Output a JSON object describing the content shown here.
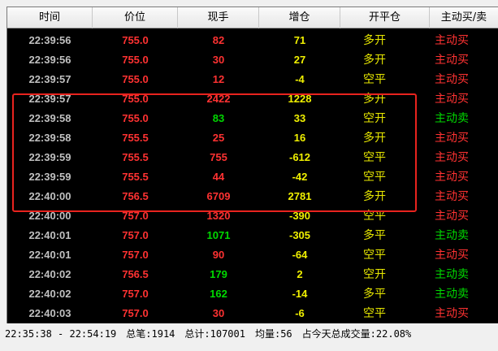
{
  "header": {
    "time": "时间",
    "price": "价位",
    "volume": "现手",
    "oi_change": "增仓",
    "open_close": "开平仓",
    "direction": "主动买/卖"
  },
  "rows": [
    {
      "time": "22:39:56",
      "price": "755.0",
      "volume": "82",
      "volume_color": "red",
      "oi": "71",
      "oc": "多开",
      "dir": "主动买",
      "dir_color": "red"
    },
    {
      "time": "22:39:56",
      "price": "755.0",
      "volume": "30",
      "volume_color": "red",
      "oi": "27",
      "oc": "多开",
      "dir": "主动买",
      "dir_color": "red"
    },
    {
      "time": "22:39:57",
      "price": "755.0",
      "volume": "12",
      "volume_color": "red",
      "oi": "-4",
      "oc": "空平",
      "dir": "主动买",
      "dir_color": "red"
    },
    {
      "time": "22:39:57",
      "price": "755.0",
      "volume": "2422",
      "volume_color": "red",
      "oi": "1228",
      "oc": "多开",
      "dir": "主动买",
      "dir_color": "red"
    },
    {
      "time": "22:39:58",
      "price": "755.0",
      "volume": "83",
      "volume_color": "green",
      "oi": "33",
      "oc": "空开",
      "dir": "主动卖",
      "dir_color": "green"
    },
    {
      "time": "22:39:58",
      "price": "755.5",
      "volume": "25",
      "volume_color": "red",
      "oi": "16",
      "oc": "多开",
      "dir": "主动买",
      "dir_color": "red"
    },
    {
      "time": "22:39:59",
      "price": "755.5",
      "volume": "755",
      "volume_color": "red",
      "oi": "-612",
      "oc": "空平",
      "dir": "主动买",
      "dir_color": "red"
    },
    {
      "time": "22:39:59",
      "price": "755.5",
      "volume": "44",
      "volume_color": "red",
      "oi": "-42",
      "oc": "空平",
      "dir": "主动买",
      "dir_color": "red"
    },
    {
      "time": "22:40:00",
      "price": "756.5",
      "volume": "6709",
      "volume_color": "red",
      "oi": "2781",
      "oc": "多开",
      "dir": "主动买",
      "dir_color": "red"
    },
    {
      "time": "22:40:00",
      "price": "757.0",
      "volume": "1320",
      "volume_color": "red",
      "oi": "-390",
      "oc": "空平",
      "dir": "主动买",
      "dir_color": "red"
    },
    {
      "time": "22:40:01",
      "price": "757.0",
      "volume": "1071",
      "volume_color": "green",
      "oi": "-305",
      "oc": "多平",
      "dir": "主动卖",
      "dir_color": "green"
    },
    {
      "time": "22:40:01",
      "price": "757.0",
      "volume": "90",
      "volume_color": "red",
      "oi": "-64",
      "oc": "空平",
      "dir": "主动买",
      "dir_color": "red"
    },
    {
      "time": "22:40:02",
      "price": "756.5",
      "volume": "179",
      "volume_color": "green",
      "oi": "2",
      "oc": "空开",
      "dir": "主动卖",
      "dir_color": "green"
    },
    {
      "time": "22:40:02",
      "price": "757.0",
      "volume": "162",
      "volume_color": "green",
      "oi": "-14",
      "oc": "多平",
      "dir": "主动卖",
      "dir_color": "green"
    },
    {
      "time": "22:40:03",
      "price": "757.0",
      "volume": "30",
      "volume_color": "red",
      "oi": "-6",
      "oc": "空平",
      "dir": "主动买",
      "dir_color": "red"
    }
  ],
  "status": {
    "range": "22:35:38 - 22:54:19",
    "total_trades": "总笔:1914",
    "total_volume": "总计:107001",
    "avg_volume": "均量:56",
    "share": "占今天总成交量:22.08%"
  },
  "colors": {
    "red": "#ff3232",
    "green": "#00d800",
    "yellow": "#f0f000",
    "highlight": "#e8231e"
  }
}
